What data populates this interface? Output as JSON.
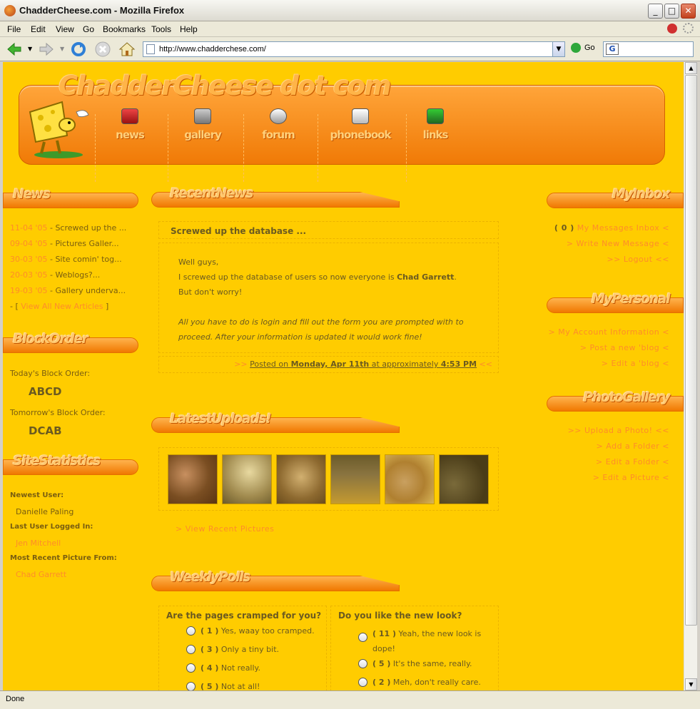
{
  "window": {
    "title": "ChadderCheese.com - Mozilla Firefox"
  },
  "menu": [
    "File",
    "Edit",
    "View",
    "Go",
    "Bookmarks",
    "Tools",
    "Help"
  ],
  "toolbar": {
    "url": "http://www.chadderchese.com/",
    "go_label": "Go"
  },
  "status": "Done",
  "site": {
    "title": "ChadderCheese dot com",
    "nav": [
      "news",
      "gallery",
      "forum",
      "phonebook",
      "links"
    ]
  },
  "left": {
    "news_title": "News",
    "news": [
      {
        "date": "11-04 '05",
        "text": " - Screwed up the ..."
      },
      {
        "date": "09-04 '05",
        "text": " - Pictures Galler..."
      },
      {
        "date": "30-03 '05",
        "text": " - Site comin' tog..."
      },
      {
        "date": "20-03 '05",
        "text": " - Weblogs?..."
      },
      {
        "date": "19-03 '05",
        "text": " - Gallery underva..."
      }
    ],
    "view_all_prefix": "- [",
    "view_all": "View All New Articles",
    "view_all_suffix": "]",
    "block_title": "BlockOrder",
    "today_label": "Today's Block Order:",
    "today_value": "ABCD",
    "tomorrow_label": "Tomorrow's Block Order:",
    "tomorrow_value": "DCAB",
    "stats_title": "SiteStatistics",
    "newest_user_label": "Newest User:",
    "newest_user": "Danielle Paling",
    "last_login_label": "Last User Logged In:",
    "last_login": "Jen Mitchell",
    "recent_pic_label": "Most Recent Picture From:",
    "recent_pic": "Chad Garrett"
  },
  "center": {
    "recent_title": "RecentNews",
    "news_headline": "Screwed up the database ...",
    "news_p1_a": "Well guys,",
    "news_p1_b": "I screwed up the database of users so now everyone is ",
    "news_p1_name": "Chad Garrett",
    "news_p1_c": ". But don't worry!",
    "news_p2": "All you have to do is login and fill out the form you are prompted with to proceed. After your information is updated it would work fine!",
    "posted_prefix": ">> ",
    "posted_a": "Posted on ",
    "posted_date": "Monday, Apr 11th",
    "posted_b": " at approximately ",
    "posted_time": "4:53 PM",
    "posted_suffix": " <<",
    "uploads_title": "LatestUploads!",
    "view_recent": "> View Recent Pictures",
    "polls_title": "WeeklyPolls",
    "poll1": {
      "question": "Are the pages cramped for you?",
      "options": [
        {
          "count": "( 1 )",
          "text": "Yes, waay too cramped."
        },
        {
          "count": "( 3 )",
          "text": "Only a tiny bit."
        },
        {
          "count": "( 4 )",
          "text": "Not really."
        },
        {
          "count": "( 5 )",
          "text": "Not at all!"
        }
      ]
    },
    "poll2": {
      "question": "Do you like the new look?",
      "options": [
        {
          "count": "( 11 )",
          "text": "Yeah, the new look is dope!"
        },
        {
          "count": "( 5 )",
          "text": "It's the same, really."
        },
        {
          "count": "( 2 )",
          "text": "Meh, don't really care."
        }
      ]
    }
  },
  "right": {
    "inbox_title": "MyInbox",
    "inbox_count": "( 0 )",
    "inbox_link": "My Messages Inbox <",
    "write_msg": "> Write New Message <",
    "logout": ">> Logout <<",
    "personal_title": "MyPersonal",
    "account": "> My Account Information <",
    "post_blog": "> Post a new 'blog <",
    "edit_blog": "> Edit a 'blog <",
    "photo_title": "PhotoGallery",
    "upload": ">> Upload a Photo! <<",
    "add_folder": "> Add a Folder <",
    "edit_folder": "> Edit a Folder <",
    "edit_picture": "> Edit a Picture <"
  }
}
